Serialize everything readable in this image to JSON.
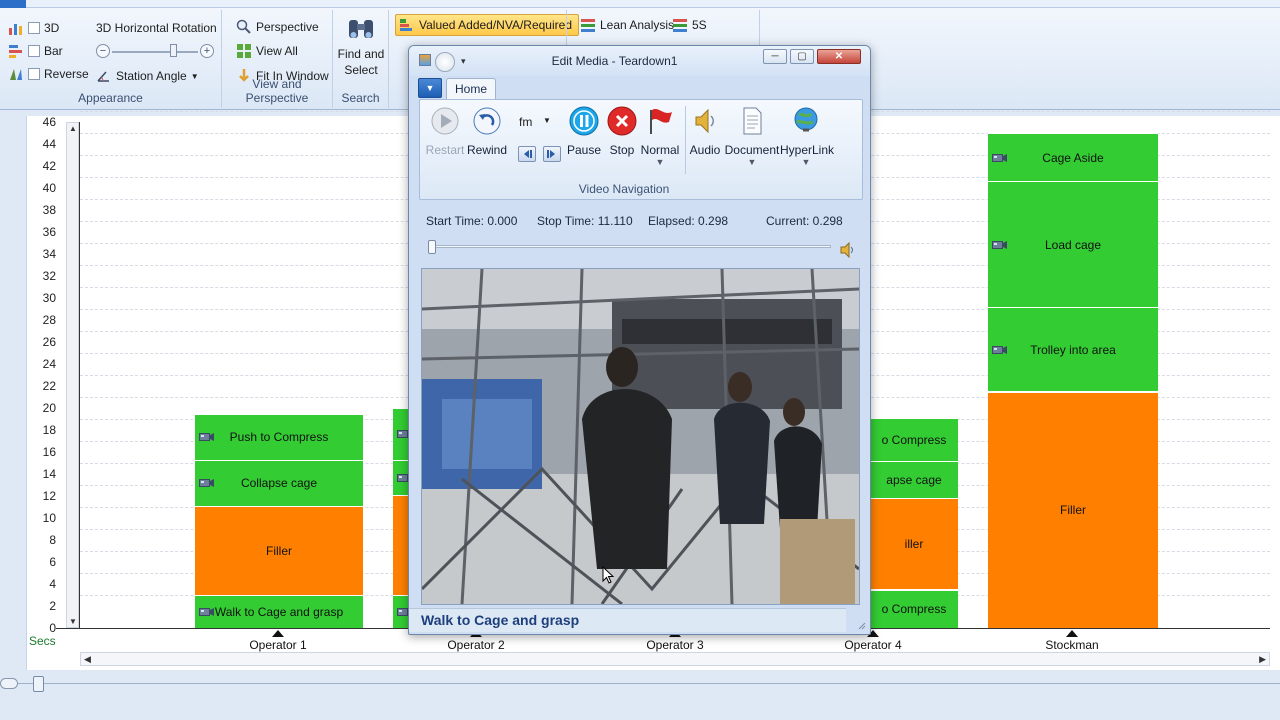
{
  "ribbon": {
    "appearance": {
      "label": "Appearance",
      "chk_3d": "3D",
      "chk_bar": "Bar",
      "chk_reverse": "Reverse",
      "rotation_label": "3D Horizontal Rotation",
      "station_angle": "Station Angle"
    },
    "view": {
      "label": "View and Perspective",
      "perspective": "Perspective",
      "view_all": "View All",
      "fit_window": "Fit In Window"
    },
    "search": {
      "label": "Search",
      "find_select_1": "Find and",
      "find_select_2": "Select"
    },
    "analysis": {
      "vanva": "Valued Added/NVA/Required",
      "lean": "Lean Analysis",
      "fives": "5S"
    }
  },
  "chart": {
    "units_label": "Secs",
    "y_ticks": [
      "46",
      "44",
      "42",
      "40",
      "38",
      "36",
      "34",
      "32",
      "30",
      "28",
      "26",
      "24",
      "22",
      "20",
      "18",
      "16",
      "14",
      "12",
      "10",
      "8",
      "6",
      "4",
      "2",
      "0"
    ]
  },
  "chart_data": {
    "type": "bar",
    "stacked": true,
    "ylabel": "Secs",
    "ylim": [
      0,
      46
    ],
    "categories": [
      "Operator 1",
      "Operator 2",
      "Operator 3",
      "Operator 4",
      "Stockman"
    ],
    "bars": [
      {
        "category": "Operator 1",
        "segments": [
          {
            "label": "Walk to Cage and grasp",
            "start": 0,
            "end": 3.0,
            "kind": "green",
            "media": true
          },
          {
            "label": "Filler",
            "start": 3.0,
            "end": 11.1,
            "kind": "orange",
            "media": false
          },
          {
            "label": "Collapse cage",
            "start": 11.1,
            "end": 15.3,
            "kind": "green",
            "media": true
          },
          {
            "label": "Push to Compress",
            "start": 15.3,
            "end": 19.5,
            "kind": "green",
            "media": true
          }
        ]
      },
      {
        "category": "Operator 2",
        "segments": [
          {
            "label": "",
            "start": 0,
            "end": 3.0,
            "kind": "green",
            "media": true
          },
          {
            "label": "",
            "start": 3.0,
            "end": 12.1,
            "kind": "orange",
            "media": false
          },
          {
            "label": "",
            "start": 12.1,
            "end": 15.3,
            "kind": "green",
            "media": true
          },
          {
            "label": "",
            "start": 15.3,
            "end": 20.0,
            "kind": "green",
            "media": true
          }
        ]
      },
      {
        "category": "Operator 4",
        "segments": [
          {
            "label": "o Compress",
            "start": 0,
            "end": 3.5,
            "kind": "green",
            "media": false
          },
          {
            "label": "iller",
            "start": 3.5,
            "end": 11.8,
            "kind": "orange",
            "media": false
          },
          {
            "label": "apse cage",
            "start": 11.8,
            "end": 15.2,
            "kind": "green",
            "media": false
          },
          {
            "label": "o Compress",
            "start": 15.2,
            "end": 19.1,
            "kind": "green",
            "media": false
          }
        ]
      },
      {
        "category": "Stockman",
        "segments": [
          {
            "label": "Filler",
            "start": 0,
            "end": 21.5,
            "kind": "orange",
            "media": false
          },
          {
            "label": "Trolley into area",
            "start": 21.5,
            "end": 29.2,
            "kind": "green",
            "media": true
          },
          {
            "label": "Load cage",
            "start": 29.2,
            "end": 40.6,
            "kind": "green",
            "media": true
          },
          {
            "label": "Cage Aside",
            "start": 40.6,
            "end": 45.0,
            "kind": "green",
            "media": true
          }
        ]
      }
    ],
    "colors": {
      "green": "#33cc33",
      "orange": "#ff8000"
    }
  },
  "dialog": {
    "title": "Edit Media - Teardown1",
    "tab_home": "Home",
    "btn_restart": "Restart",
    "btn_rewind": "Rewind",
    "unit_value": "fm",
    "btn_pause": "Pause",
    "btn_stop": "Stop",
    "btn_normal": "Normal",
    "btn_audio": "Audio",
    "btn_document": "Document",
    "btn_hyperlink": "HyperLink",
    "group_label": "Video Navigation",
    "start_time": "Start Time:  0.000",
    "stop_time": "Stop Time:  11.110",
    "elapsed": "Elapsed:  0.298",
    "current": "Current:  0.298",
    "caption": "Walk to Cage and grasp",
    "progress_fraction": 0.027
  }
}
